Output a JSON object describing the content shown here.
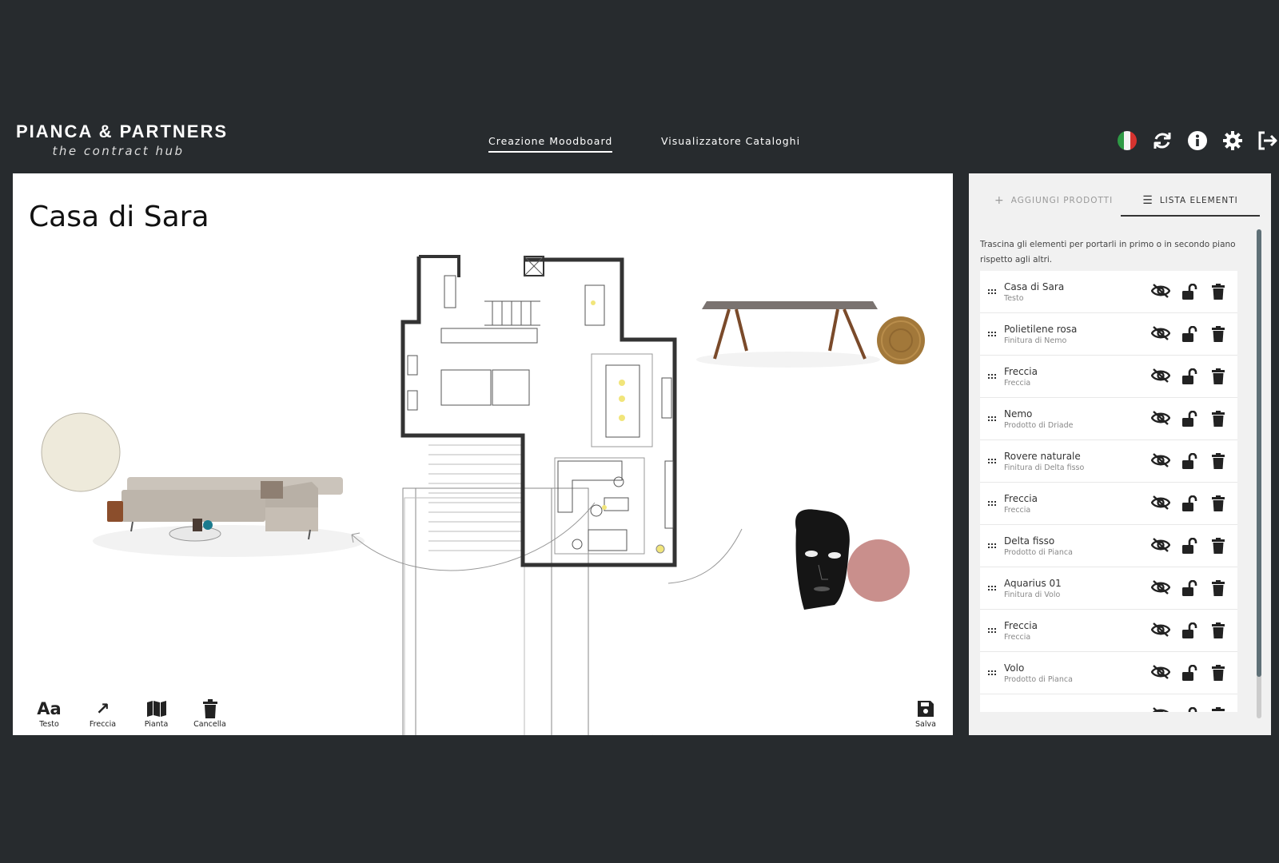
{
  "brand": {
    "name": "PIANCA & PARTNERS",
    "tagline": "the contract hub"
  },
  "nav": {
    "items": [
      "Creazione Moodboard",
      "Visualizzatore Cataloghi"
    ],
    "active": 0
  },
  "header_icons": [
    "italy-flag-icon",
    "refresh-icon",
    "info-icon",
    "settings-icon",
    "logout-icon"
  ],
  "board": {
    "title": "Casa di Sara",
    "toolbar": [
      {
        "label": "Testo",
        "icon": "text-icon",
        "glyph": "Aa"
      },
      {
        "label": "Freccia",
        "icon": "arrow-icon",
        "glyph": "↗"
      },
      {
        "label": "Pianta",
        "icon": "map-icon",
        "glyph": ""
      },
      {
        "label": "Cancella",
        "icon": "trash-icon",
        "glyph": ""
      }
    ],
    "save_label": "Salva"
  },
  "panel": {
    "tabs": [
      {
        "label": "AGGIUNGI PRODOTTI",
        "icon": "plus-icon",
        "glyph": "+"
      },
      {
        "label": "LISTA ELEMENTI",
        "icon": "list-icon",
        "glyph": "☰"
      }
    ],
    "active_tab": 1,
    "hint": "Trascina gli elementi per portarli in primo o in secondo piano rispetto agli altri.",
    "items": [
      {
        "name": "Casa di Sara",
        "sub": "Testo"
      },
      {
        "name": "Polietilene rosa",
        "sub": "Finitura di Nemo"
      },
      {
        "name": "Freccia",
        "sub": "Freccia"
      },
      {
        "name": "Nemo",
        "sub": "Prodotto di Driade"
      },
      {
        "name": "Rovere naturale",
        "sub": "Finitura di Delta fisso"
      },
      {
        "name": "Freccia",
        "sub": "Freccia"
      },
      {
        "name": "Delta fisso",
        "sub": "Prodotto di Pianca"
      },
      {
        "name": "Aquarius 01",
        "sub": "Finitura di Volo"
      },
      {
        "name": "Freccia",
        "sub": "Freccia"
      },
      {
        "name": "Volo",
        "sub": "Prodotto di Pianca"
      },
      {
        "name": "",
        "sub": ""
      }
    ]
  },
  "colors": {
    "background": "#272b2e",
    "canvas": "#ffffff",
    "panel": "#f1f1f1",
    "swatch_pink": "#c98f8c",
    "swatch_oak": "#a2783a",
    "swatch_fabric": "#eeeadb"
  }
}
